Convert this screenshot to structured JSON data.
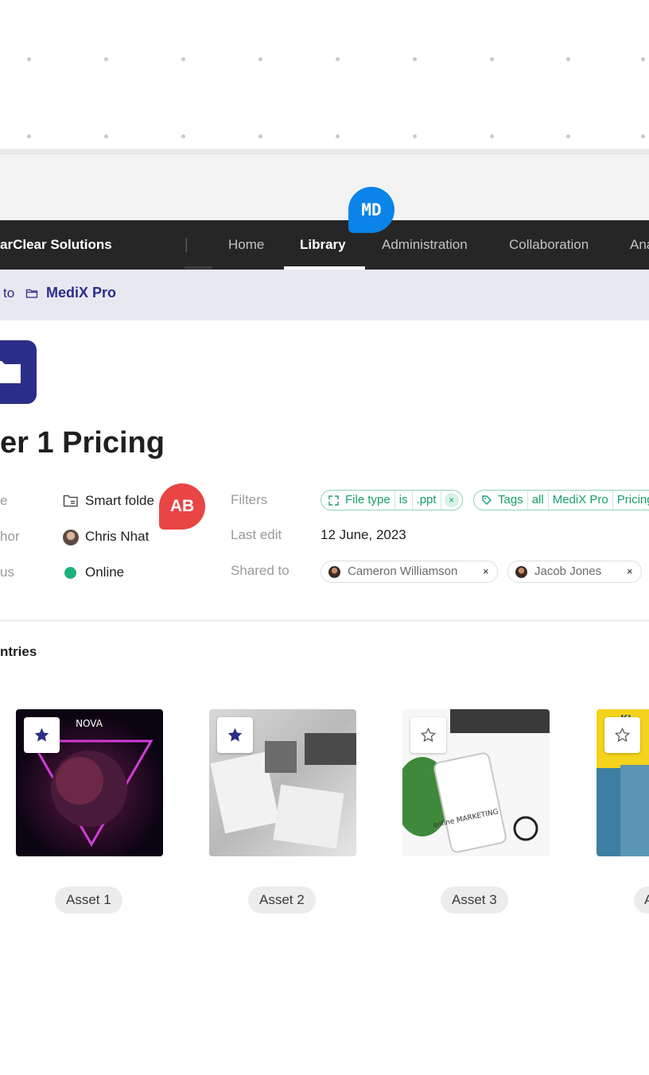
{
  "header": {
    "brand": "arClear Solutions",
    "separator": "|",
    "nav": [
      {
        "label": "Home",
        "active": false
      },
      {
        "label": "Library",
        "active": true
      },
      {
        "label": "Administration",
        "active": false
      },
      {
        "label": "Collaboration",
        "active": false
      },
      {
        "label": "Ana",
        "active": false
      }
    ]
  },
  "presence": {
    "top_avatar": "MD",
    "inline_avatar": "AB"
  },
  "breadcrumb": {
    "prefix": "to",
    "current": "MediX Pro",
    "icon": "folder-icon"
  },
  "page": {
    "title": "er 1 Pricing"
  },
  "meta": {
    "type_label": "e",
    "type_value": "Smart folde",
    "author_label": "hor",
    "author_value": "Chris Nhat",
    "status_label": "us",
    "status_value": "Online",
    "status_color": "#1db37a",
    "filters_label": "Filters",
    "filters": [
      {
        "icon": "expand-icon",
        "segments": [
          "File type",
          "is",
          ".ppt"
        ]
      },
      {
        "icon": "tag-icon",
        "segments": [
          "Tags",
          "all",
          "MediX Pro",
          "Pricing"
        ]
      }
    ],
    "last_edit_label": "Last edit",
    "last_edit_value": "12 June, 2023",
    "shared_label": "Shared to",
    "shared": [
      "Cameron Williamson",
      "Jacob Jones"
    ],
    "remove_glyph": "×"
  },
  "entries": {
    "title": "ntries",
    "items": [
      {
        "label": "Asset 1",
        "starred": true,
        "thumb_text": "NOVA"
      },
      {
        "label": "Asset 2",
        "starred": true,
        "thumb_text": ""
      },
      {
        "label": "Asset 3",
        "starred": false,
        "thumb_text": "online MARKETING"
      },
      {
        "label": "A",
        "starred": false,
        "thumb_text": "KI"
      }
    ]
  },
  "colors": {
    "accent": "#2b2e86",
    "navbar": "#262626",
    "chip_green": "#1a9e6a",
    "avatar_blue": "#0a84e8",
    "avatar_red": "#e94545"
  }
}
